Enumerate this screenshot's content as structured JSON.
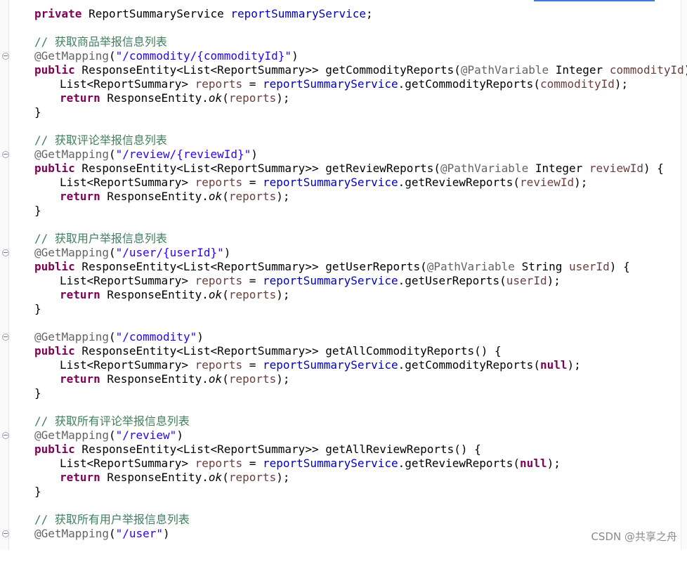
{
  "code": {
    "line_field": "private ReportSummaryService reportSummaryService;",
    "comment_commodity": "// 获取商品举报信息列表",
    "mapping_commodity_id": "@GetMapping(\"/commodity/{commodityId}\")",
    "sig_commodity": "public ResponseEntity<List<ReportSummary>> getCommodityReports(@PathVariable Integer commodityId) {",
    "body_commodity": "List<ReportSummary> reports = reportSummaryService.getCommodityReports(commodityId);",
    "return_stmt": "return ResponseEntity.ok(reports);",
    "close_brace": "}",
    "comment_review": "// 获取评论举报信息列表",
    "mapping_review_id": "@GetMapping(\"/review/{reviewId}\")",
    "sig_review": "public ResponseEntity<List<ReportSummary>> getReviewReports(@PathVariable Integer reviewId) {",
    "body_review": "List<ReportSummary> reports = reportSummaryService.getReviewReports(reviewId);",
    "comment_user": "// 获取用户举报信息列表",
    "mapping_user_id": "@GetMapping(\"/user/{userId}\")",
    "sig_user": "public ResponseEntity<List<ReportSummary>> getUserReports(@PathVariable String userId) {",
    "body_user": "List<ReportSummary> reports = reportSummaryService.getUserReports(userId);",
    "mapping_commodity_all": "@GetMapping(\"/commodity\")",
    "sig_commodity_all": "public ResponseEntity<List<ReportSummary>> getAllCommodityReports() {",
    "body_commodity_all": "List<ReportSummary> reports = reportSummaryService.getCommodityReports(null);",
    "comment_review_all": "// 获取所有评论举报信息列表",
    "mapping_review_all": "@GetMapping(\"/review\")",
    "sig_review_all": "public ResponseEntity<List<ReportSummary>> getAllReviewReports() {",
    "body_review_all": "List<ReportSummary> reports = reportSummaryService.getReviewReports(null);",
    "comment_user_all": "// 获取所有用户举报信息列表",
    "mapping_user_all": "@GetMapping(\"/user\")"
  },
  "watermark": "CSDN @共享之舟",
  "colors": {
    "keyword": "#7f0055",
    "comment": "#3f7f5f",
    "string": "#2a00ff",
    "annotation": "#646464",
    "field": "#0000c0",
    "variable": "#6a3e3e"
  }
}
